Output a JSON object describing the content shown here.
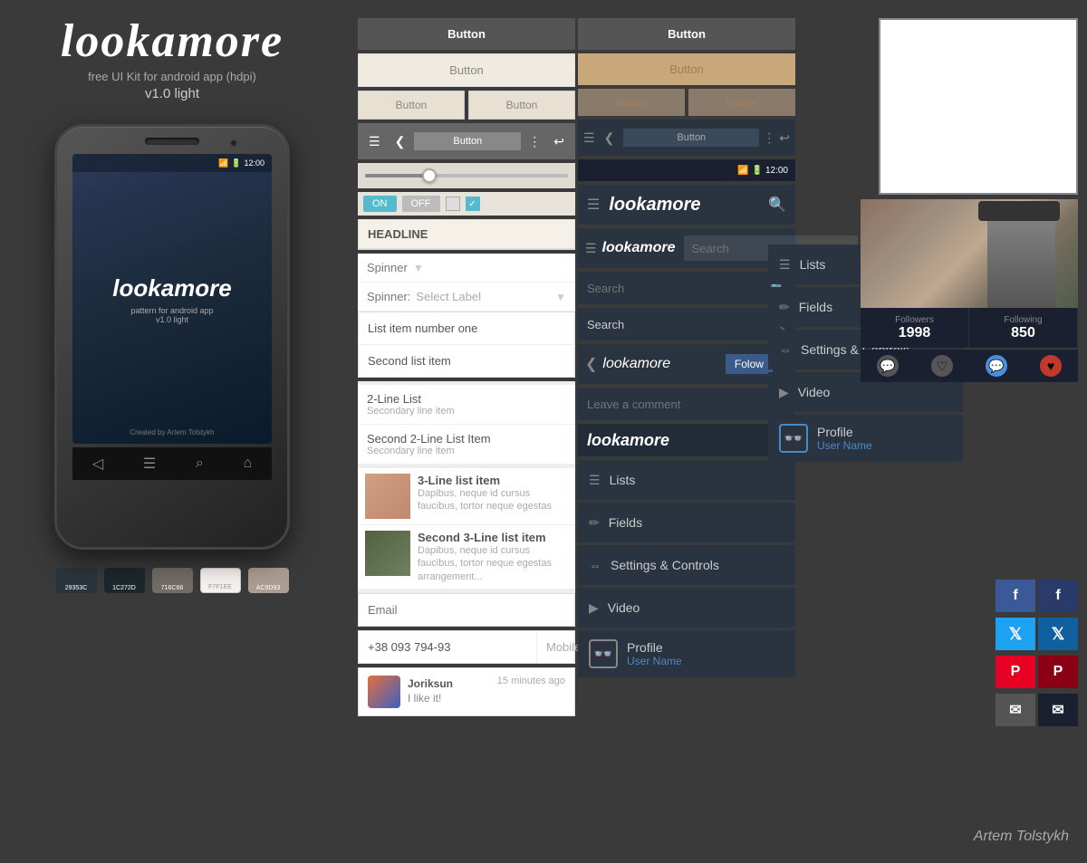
{
  "brand": {
    "logo": "lookamore",
    "tagline": "free UI Kit for android app (hdpi)",
    "version": "v1.0 light",
    "phone_logo": "lookamore",
    "phone_pattern": "pattern for android app",
    "phone_version": "v1.0 light",
    "phone_credit": "Created by Artem Tolstykh"
  },
  "swatches": [
    {
      "color": "#29353C",
      "label": "29353C"
    },
    {
      "color": "#1C272D",
      "label": "1C272D"
    },
    {
      "color": "#716C66",
      "label": "716C66"
    },
    {
      "color": "#F7F1EE",
      "label": "F7F1EE"
    },
    {
      "color": "#AC9D93",
      "label": "AC9D93"
    }
  ],
  "buttons": {
    "primary_label": "Button",
    "secondary_label": "Button"
  },
  "light_components": {
    "headline": "HEADLINE",
    "spinner1": "Spinner",
    "spinner2_label": "Spinner:",
    "spinner2_select": "Select Label",
    "list_items": [
      "List item number one",
      "Second list item"
    ],
    "two_line_items": [
      {
        "primary": "2-Line List",
        "secondary": "Secondary line item"
      },
      {
        "primary": "Second 2-Line List Item",
        "secondary": "Secondary line item"
      }
    ],
    "three_line_items": [
      {
        "title": "3-Line list item",
        "desc": "Dapibus, neque id cursus faucibus, tortor neque egestas"
      },
      {
        "title": "Second 3-Line list item",
        "desc": "Dapibus, neque id cursus faucibus, tortor neque egestas arrangement..."
      }
    ],
    "toggle_on": "ON",
    "toggle_off": "OFF",
    "email_placeholder": "Email",
    "phone_number": "+38 093 794-93",
    "phone_type": "Mobile"
  },
  "comment": {
    "avatar_name": "Joriksun",
    "time": "15 minutes ago",
    "text": "I like it!"
  },
  "dark_components": {
    "logo": "lookamore",
    "search_placeholder1": "Search",
    "search_placeholder2": "Search",
    "follow_label": "Folow",
    "comment_placeholder": "Leave a comment",
    "nav_items": [
      "Lists",
      "Fields",
      "Settings & Controls",
      "Video"
    ],
    "profile_name": "Profile",
    "profile_username": "User Name"
  },
  "stats": {
    "followers_label": "Followers",
    "followers_value": "1998",
    "following_label": "Following",
    "following_value": "850"
  },
  "social": {
    "facebook": "f",
    "twitter": "t",
    "pinterest": "p",
    "mail": "✉"
  },
  "credit": "Artem Tolstykh",
  "status_time": "12:00"
}
